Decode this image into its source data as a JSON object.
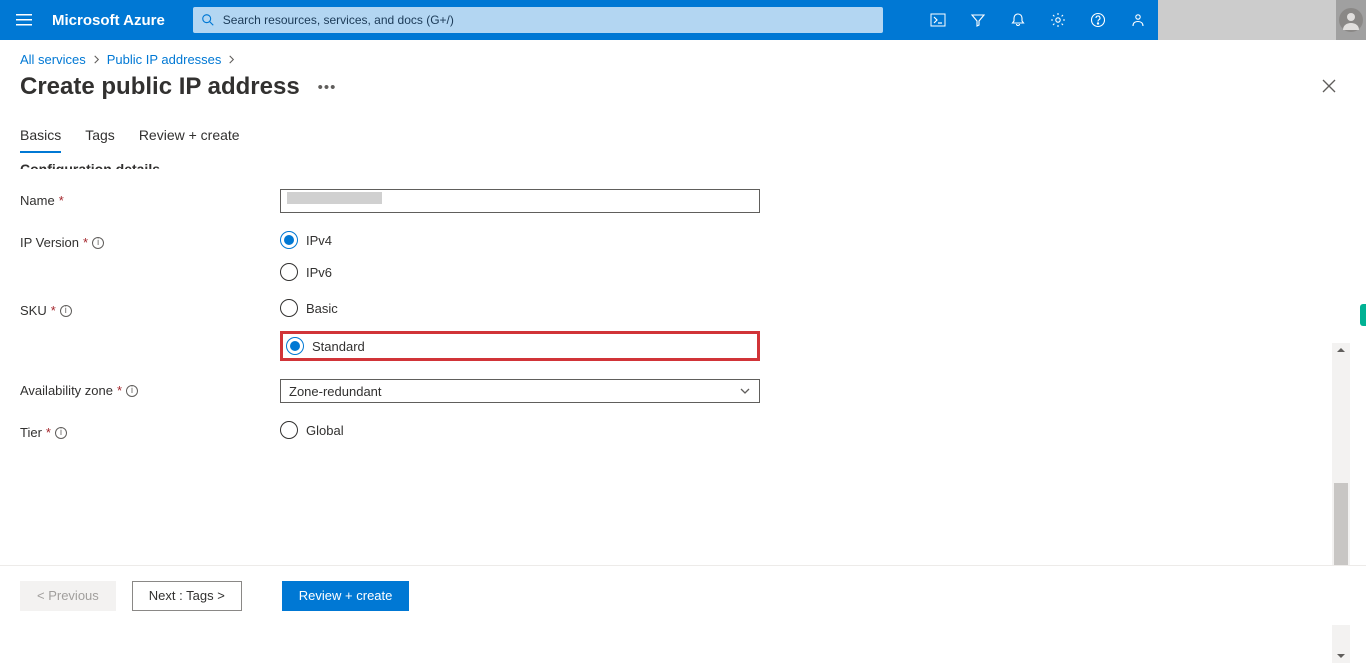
{
  "brand": "Microsoft Azure",
  "search": {
    "placeholder": "Search resources, services, and docs (G+/)"
  },
  "breadcrumb": {
    "all_services": "All services",
    "public_ips": "Public IP addresses"
  },
  "page_title": "Create public IP address",
  "tabs": {
    "basics": "Basics",
    "tags": "Tags",
    "review": "Review + create"
  },
  "section": {
    "config": "Configuration details"
  },
  "labels": {
    "name": "Name",
    "ip_version": "IP Version",
    "sku": "SKU",
    "availability_zone": "Availability zone",
    "tier": "Tier"
  },
  "options": {
    "ipv4": "IPv4",
    "ipv6": "IPv6",
    "basic": "Basic",
    "standard": "Standard",
    "global": "Global"
  },
  "availability_zone_value": "Zone-redundant",
  "footer": {
    "previous": "< Previous",
    "next": "Next : Tags >",
    "review": "Review + create"
  }
}
